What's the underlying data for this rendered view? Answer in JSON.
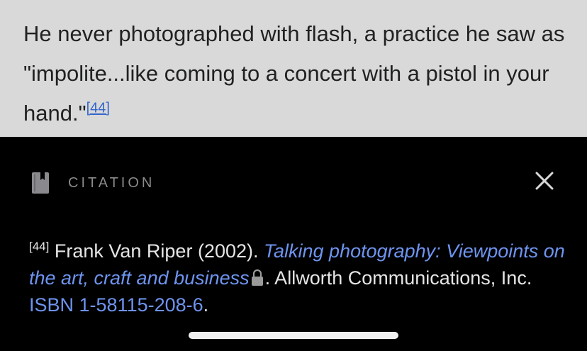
{
  "article": {
    "text_before": "He never photographed with flash, a practice he saw as \"impolite...like coming to a concert with a pistol in your hand.\"",
    "ref_label": "[44]"
  },
  "citation_sheet": {
    "header_label": "CITATION",
    "icons": {
      "header": "bookmark-icon",
      "close": "close-icon",
      "access": "lock-icon"
    },
    "number": "[44]",
    "author_date": " Frank Van Riper (2002). ",
    "title": "Talking photography: Viewpoints on the art, craft and business",
    "after_title": ". Allworth Communications, Inc. ",
    "isbn": "ISBN 1-58115-208-6",
    "end": "."
  },
  "colors": {
    "article_bg": "#d9d9d9",
    "sheet_bg": "#000000",
    "link": "#3366cc",
    "link_dark": "#6e94f0"
  }
}
